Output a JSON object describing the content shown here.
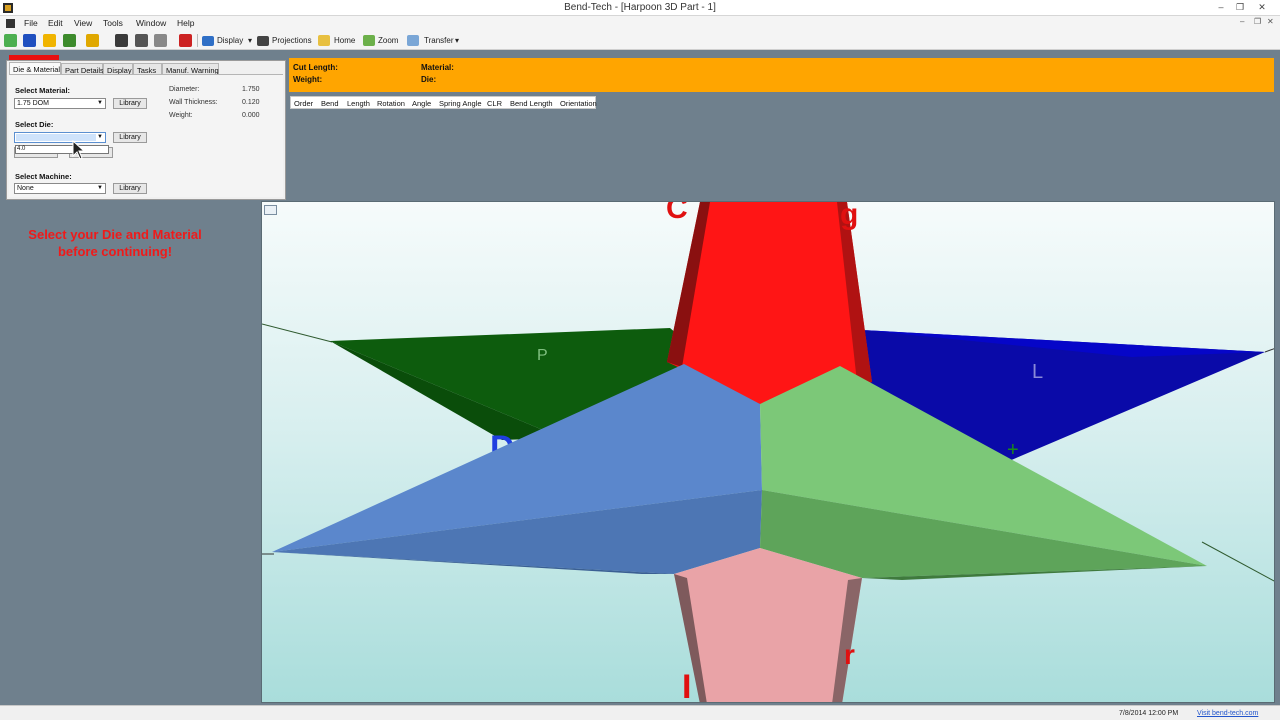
{
  "window": {
    "title": "Bend-Tech - [Harpoon 3D Part - 1]"
  },
  "menu": [
    "File",
    "Edit",
    "View",
    "Tools",
    "Window",
    "Help"
  ],
  "toolbar": {
    "display_label": "Display",
    "projections_label": "Projections",
    "home_label": "Home",
    "zoom_label": "Zoom",
    "transfer_label": "Transfer"
  },
  "tabs": [
    "Die & Material",
    "Part Details",
    "Display",
    "Tasks",
    "Manuf. Warning"
  ],
  "die_material": {
    "select_material_label": "Select Material:",
    "material_value": "1.75 DOM",
    "library_label": "Library",
    "select_die_label": "Select Die:",
    "die_value": "",
    "die_option": "4.0",
    "custom_clr_label": "Custom CLR",
    "select_list_label": "Select List",
    "select_machine_label": "Select Machine:",
    "machine_value": "None",
    "diameter_label": "Diameter:",
    "diameter_value": "1.750",
    "wall_label": "Wall Thickness:",
    "wall_value": "0.120",
    "weight_label": "Weight:",
    "weight_value": "0.000"
  },
  "warning": "Select your Die and Material before continuing!",
  "summary": {
    "cut_length_label": "Cut Length:",
    "weight_label": "Weight:",
    "material_label": "Material:",
    "die_label": "Die:"
  },
  "columns": [
    "Order",
    "Bend",
    "Length",
    "Rotation",
    "Angle",
    "Spring Angle",
    "CLR",
    "Bend Length",
    "Orientation"
  ],
  "status": {
    "datetime": "7/8/2014   12:00 PM",
    "link": "Visit bend-tech.com"
  },
  "colors": {
    "accent_orange": "#ffa500",
    "warning_red": "#ef1a1a",
    "axis_red": "#ff1515",
    "axis_green": "#0a6a0a",
    "axis_blue": "#0000cc"
  }
}
